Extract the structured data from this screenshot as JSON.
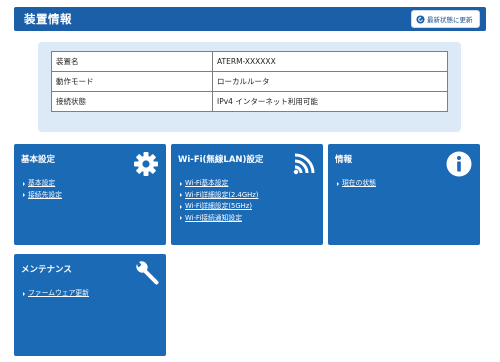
{
  "header": {
    "title": "装置情報",
    "refresh_label": "最新状態に更新",
    "refresh_icon": "refresh-icon"
  },
  "device_info": {
    "rows": [
      {
        "label": "装置名",
        "value": "ATERM-XXXXXX"
      },
      {
        "label": "動作モード",
        "value": "ローカルルータ"
      },
      {
        "label": "接続状態",
        "value": "IPv4 インターネット利用可能"
      }
    ]
  },
  "cards": {
    "basic": {
      "title": "基本設定",
      "icon": "gear-icon",
      "links": [
        "基本設定",
        "接続先設定"
      ]
    },
    "wifi": {
      "title": "Wi-Fi(無線LAN)設定",
      "icon": "wifi-icon",
      "links": [
        "Wi-Fi基本設定",
        "Wi-Fi詳細設定(2.4GHz)",
        "Wi-Fi詳細設定(5GHz)",
        "Wi-Fi接続通知設定"
      ]
    },
    "info": {
      "title": "情報",
      "icon": "info-icon",
      "links": [
        "現在の状態"
      ]
    },
    "maintenance": {
      "title": "メンテナンス",
      "icon": "wrench-icon",
      "links": [
        "ファームウェア更新"
      ]
    }
  },
  "colors": {
    "header_bg": "#1a5fa8",
    "card_bg": "#1a6ab6",
    "panel_bg": "#dce9f6"
  }
}
